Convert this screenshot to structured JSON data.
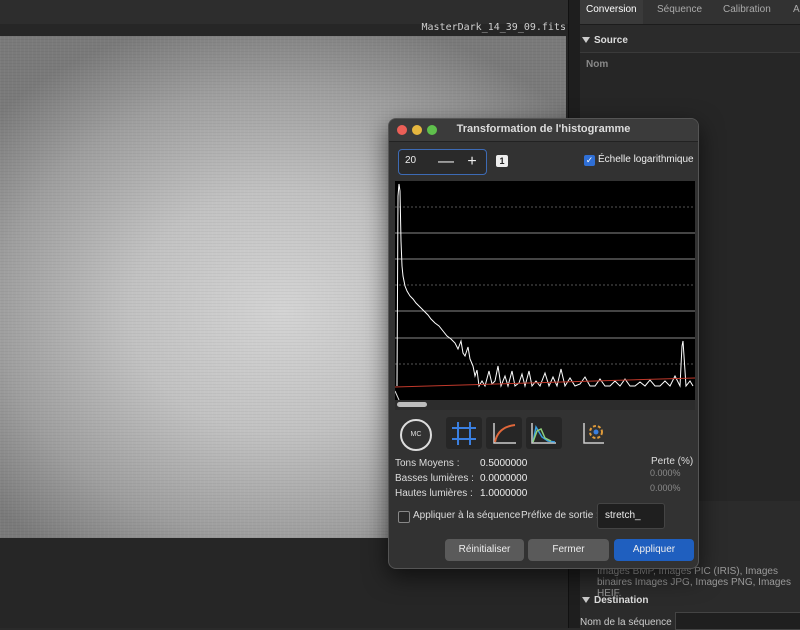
{
  "image_view": {
    "filename": "MasterDark_14_39_09.fits"
  },
  "right_panel": {
    "tabs": [
      "Conversion",
      "Séquence",
      "Calibration",
      "A"
    ],
    "source_label": "Source",
    "nom_label": "Nom",
    "formats_text": "Images BMP, Images PIC (IRIS), Images binaires Images JPG, Images PNG, Images HEIF.",
    "destination_label": "Destination",
    "sequence_name_label": "Nom de la séquence :"
  },
  "dialog": {
    "title": "Transformation de l'histogramme",
    "zoom_value": "20",
    "minus_glyph": "—",
    "plus_glyph": "+",
    "badge": "1",
    "log_scale_label": "Échelle logarithmique",
    "log_scale_checked": true,
    "mc_label": "MC",
    "tons_moyens_label": "Tons Moyens :",
    "tons_moyens_value": "0.5000000",
    "basses_label": "Basses lumières :",
    "basses_value": "0.0000000",
    "hautes_label": "Hautes lumières :",
    "hautes_value": "1.0000000",
    "perte_label": "Perte (%)",
    "perte_low": "0.000%",
    "perte_high": "0.000%",
    "apply_sequence_label": "Appliquer à la séquence",
    "prefix_label": "Préfixe de sortie :",
    "prefix_value": "stretch_",
    "reset_label": "Réinitialiser",
    "close_label": "Fermer",
    "apply_label": "Appliquer"
  },
  "colors": {
    "accent": "#2f6fd6",
    "apply_button": "#1f5fbf",
    "curve_red": "#c0392b"
  }
}
